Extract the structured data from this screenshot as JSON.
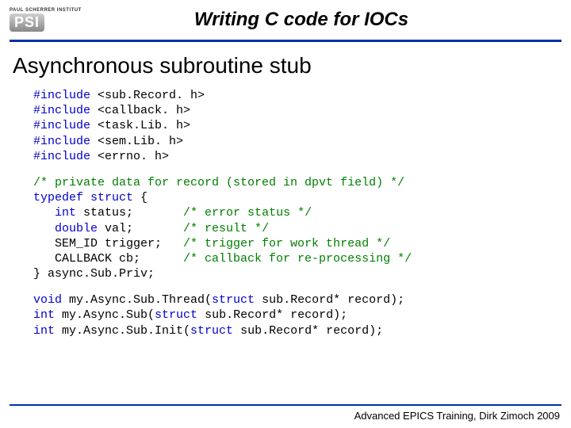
{
  "header": {
    "logo_top": "PAUL SCHERRER INSTITUT",
    "logo_text": "PSI",
    "title": "Writing C code for IOCs"
  },
  "subhead": "Asynchronous subroutine stub",
  "code": {
    "inc_kw": "#include",
    "inc1": " <sub.Record. h>",
    "inc2": " <callback. h>",
    "inc3": " <task.Lib. h>",
    "inc4": " <sem.Lib. h>",
    "inc5": " <errno. h>",
    "cm1": "/* private data for record (stored in dpvt field) */",
    "td_kw": "typedef struct",
    "td_open": " {",
    "f1a": "   int",
    "f1b": " status;       ",
    "f1c": "/* error status */",
    "f2a": "   double",
    "f2b": " val;       ",
    "f2c": "/* result */",
    "f3a": "   SEM_ID trigger;   ",
    "f3c": "/* trigger for work thread */",
    "f4a": "   CALLBACK cb;      ",
    "f4c": "/* callback for re-processing */",
    "td_close": "} async.Sub.Priv;",
    "p1a": "void",
    "p1b": " my.Async.Sub.Thread(",
    "p1c": "struct",
    "p1d": " sub.Record* record);",
    "p2a": "int",
    "p2b": " my.Async.Sub(",
    "p2c": "struct",
    "p2d": " sub.Record* record);",
    "p3a": "int",
    "p3b": " my.Async.Sub.Init(",
    "p3c": "struct",
    "p3d": " sub.Record* record);"
  },
  "footer": "Advanced EPICS Training, Dirk Zimoch 2009"
}
